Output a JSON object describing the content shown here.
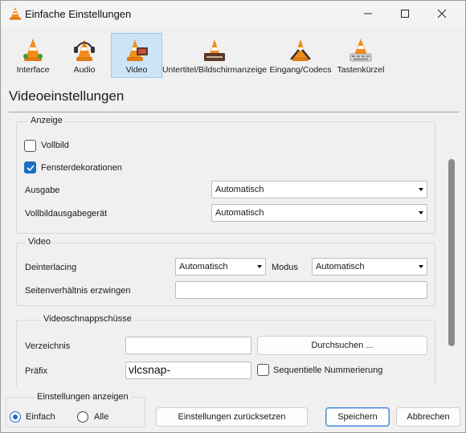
{
  "window": {
    "title": "Einfache Einstellungen"
  },
  "toolbar": {
    "items": [
      {
        "label": "Interface",
        "icon": "interface-cone-icon",
        "active": false
      },
      {
        "label": "Audio",
        "icon": "audio-cone-icon",
        "active": false
      },
      {
        "label": "Video",
        "icon": "video-cone-icon",
        "active": true
      },
      {
        "label": "Untertitel/Bildschirmanzeige",
        "icon": "subtitles-cone-icon",
        "active": false
      },
      {
        "label": "Eingang/Codecs",
        "icon": "input-codecs-cone-icon",
        "active": false
      },
      {
        "label": "Tastenkürzel",
        "icon": "hotkeys-cone-icon",
        "active": false
      }
    ]
  },
  "page": {
    "title": "Videoeinstellungen"
  },
  "display_group": {
    "title": "Anzeige",
    "fullscreen_label": "Vollbild",
    "fullscreen_checked": false,
    "decorations_label": "Fensterdekorationen",
    "decorations_checked": true,
    "output_label": "Ausgabe",
    "output_value": "Automatisch",
    "fullscreen_device_label": "Vollbildausgabegerät",
    "fullscreen_device_value": "Automatisch"
  },
  "video_group": {
    "title": "Video",
    "deinterlacing_label": "Deinterlacing",
    "deinterlacing_value": "Automatisch",
    "mode_label": "Modus",
    "mode_value": "Automatisch",
    "aspect_label": "Seitenverhältnis erzwingen",
    "aspect_value": ""
  },
  "snapshot_group": {
    "title": "Videoschnappschüsse",
    "directory_label": "Verzeichnis",
    "directory_value": "",
    "browse_button": "Durchsuchen ...",
    "prefix_label": "Präfix",
    "prefix_value": "vlcsnap-",
    "sequential_label": "Sequentielle Nummerierung",
    "sequential_checked": false
  },
  "footer": {
    "show_settings_title": "Einstellungen anzeigen",
    "simple_label": "Einfach",
    "simple_selected": true,
    "all_label": "Alle",
    "all_selected": false,
    "reset_button": "Einstellungen zurücksetzen",
    "save_button": "Speichern",
    "cancel_button": "Abbrechen"
  },
  "colors": {
    "accent": "#1a6fc4",
    "active_tab": "#cce4f7",
    "cone_orange": "#f28c1b"
  }
}
